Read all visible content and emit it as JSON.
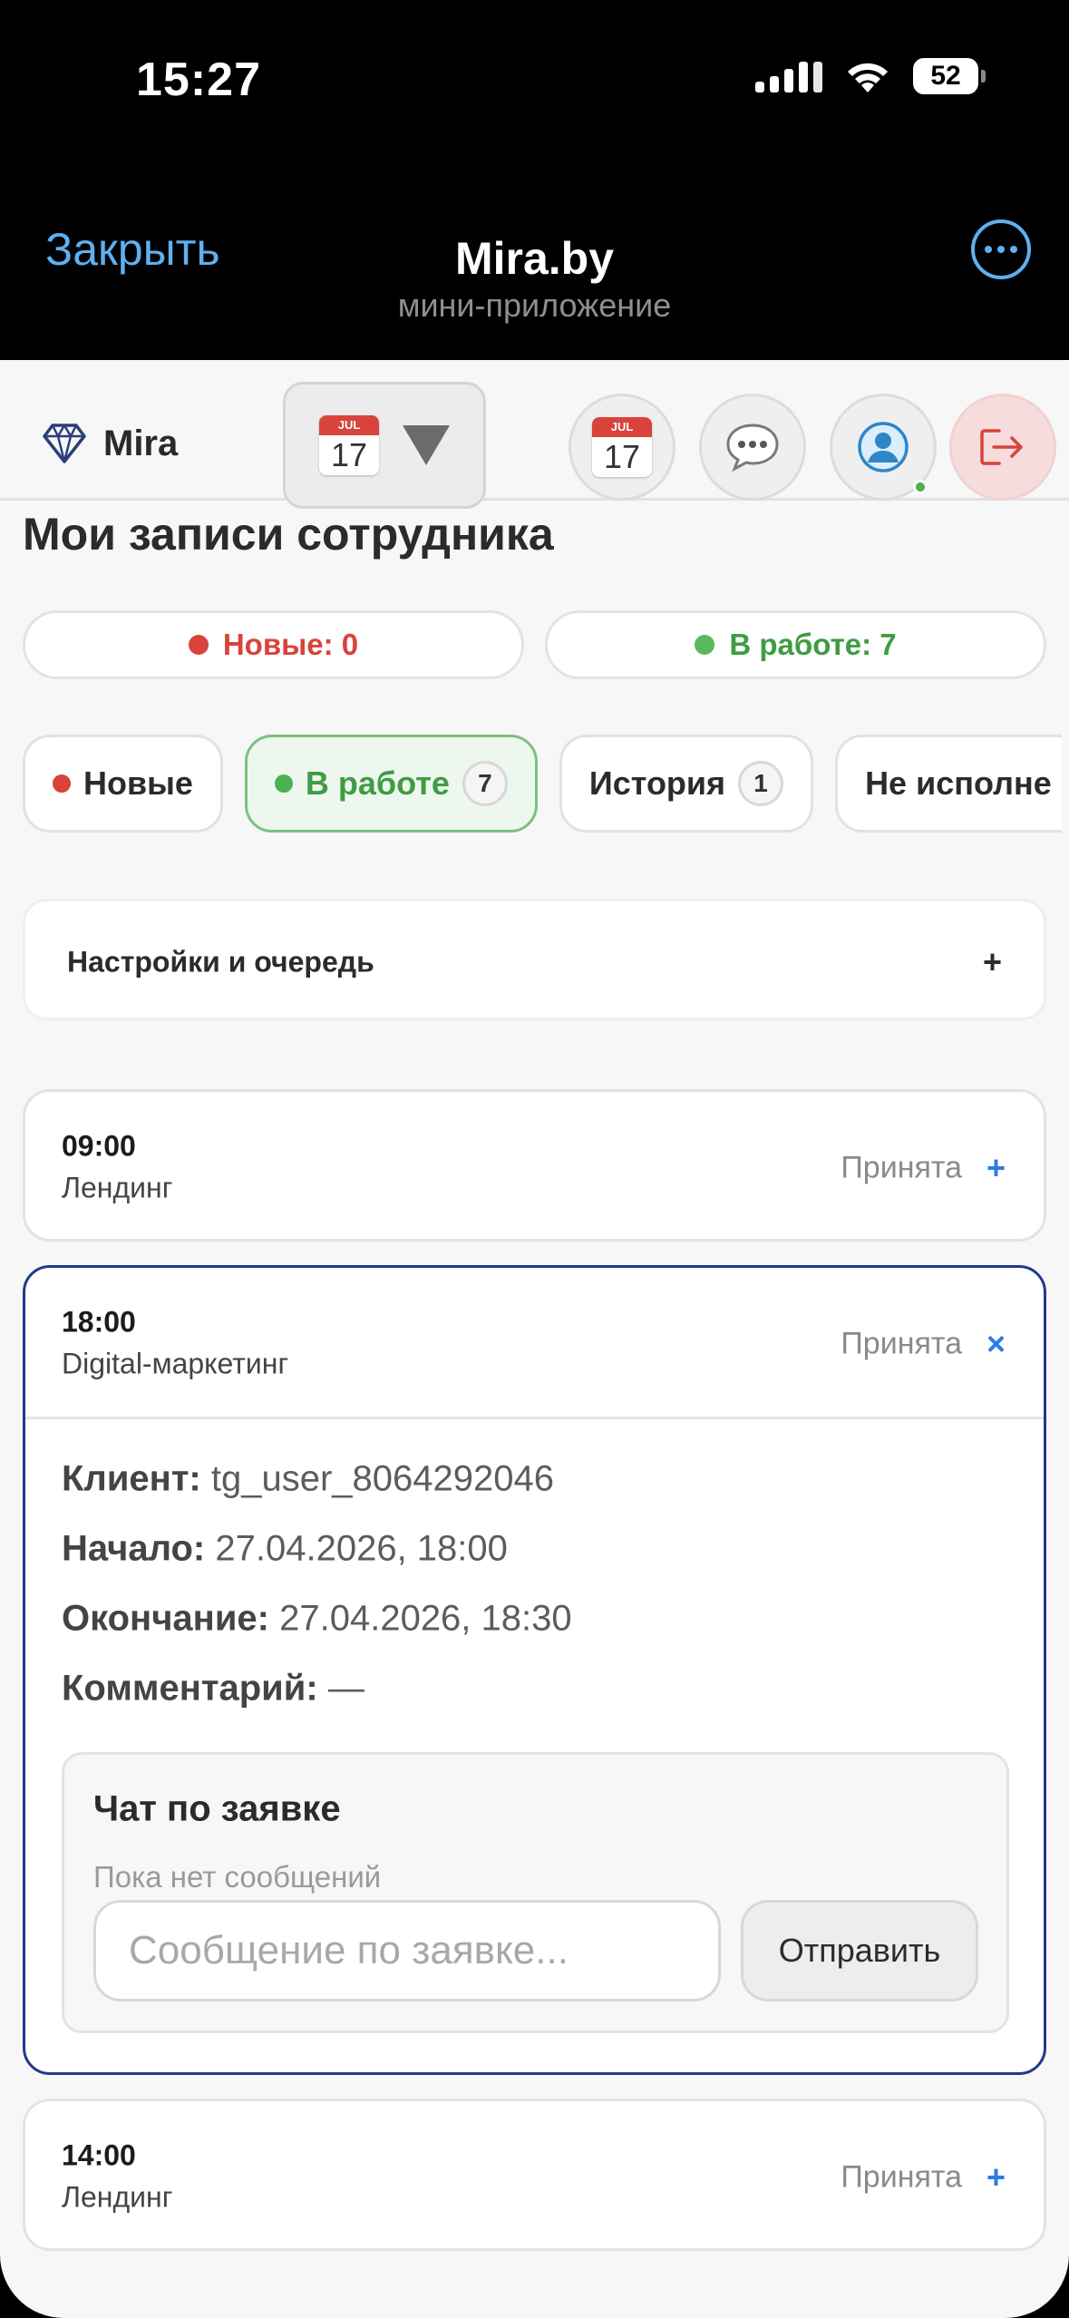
{
  "status_bar": {
    "time": "15:27",
    "battery": "52"
  },
  "telegram": {
    "close_label": "Закрыть",
    "title": "Mira.by",
    "subtitle": "мини-приложение"
  },
  "app_bar": {
    "brand": "Mira",
    "calendar_month": "JUL",
    "calendar_day": "17"
  },
  "page_title": "Мои записи сотрудника",
  "summary": {
    "new_label": "Новые: 0",
    "new_color": "#d9433b",
    "in_work_label": "В работе: 7",
    "in_work_color": "#4caf50"
  },
  "tabs": [
    {
      "label": "Новые",
      "dot_color": "#d9433b"
    },
    {
      "label": "В работе",
      "count": "7",
      "dot_color": "#4caf50",
      "active": true
    },
    {
      "label": "История",
      "count": "1"
    },
    {
      "label": "Не исполне"
    }
  ],
  "settings": {
    "title": "Настройки и очередь",
    "toggle": "+"
  },
  "appointments": [
    {
      "time": "09:00",
      "service": "Лендинг",
      "status": "Принята",
      "toggle": "+"
    },
    {
      "time": "18:00",
      "service": "Digital-маркетинг",
      "status": "Принята",
      "toggle": "×",
      "details": {
        "client_label": "Клиент:",
        "client_value": "tg_user_8064292046",
        "start_label": "Начало:",
        "start_value": "27.04.2026, 18:00",
        "end_label": "Окончание:",
        "end_value": "27.04.2026, 18:30",
        "comment_label": "Комментарий:",
        "comment_value": "—"
      },
      "chat": {
        "title": "Чат по заявке",
        "empty_text": "Пока нет сообщений",
        "input_placeholder": "Сообщение по заявке...",
        "send_label": "Отправить"
      }
    },
    {
      "time": "14:00",
      "service": "Лендинг",
      "status": "Принята",
      "toggle": "+"
    }
  ]
}
